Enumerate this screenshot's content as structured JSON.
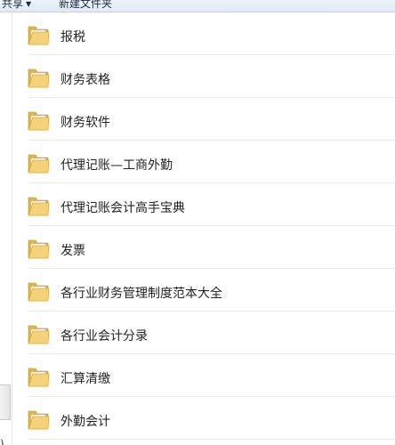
{
  "toolbar": {
    "share_label": "共享",
    "new_folder_label": "新建文件夹"
  },
  "nav_pane": {
    "partial_glyph": ")"
  },
  "files": [
    {
      "name": "报税",
      "icon": "folder-icon"
    },
    {
      "name": "财务表格",
      "icon": "folder-icon"
    },
    {
      "name": "财务软件",
      "icon": "folder-icon"
    },
    {
      "name": "代理记账—工商外勤",
      "icon": "folder-icon"
    },
    {
      "name": "代理记账会计高手宝典",
      "icon": "folder-icon"
    },
    {
      "name": "发票",
      "icon": "folder-icon"
    },
    {
      "name": "各行业财务管理制度范本大全",
      "icon": "folder-icon"
    },
    {
      "name": "各行业会计分录",
      "icon": "folder-icon"
    },
    {
      "name": "汇算清缴",
      "icon": "folder-icon"
    },
    {
      "name": "外勤会计",
      "icon": "folder-icon"
    }
  ],
  "colors": {
    "folder_front": "#f3d27a",
    "folder_back": "#e2b54c",
    "separator": "#ececec",
    "toolbar": "#e6eef8"
  }
}
